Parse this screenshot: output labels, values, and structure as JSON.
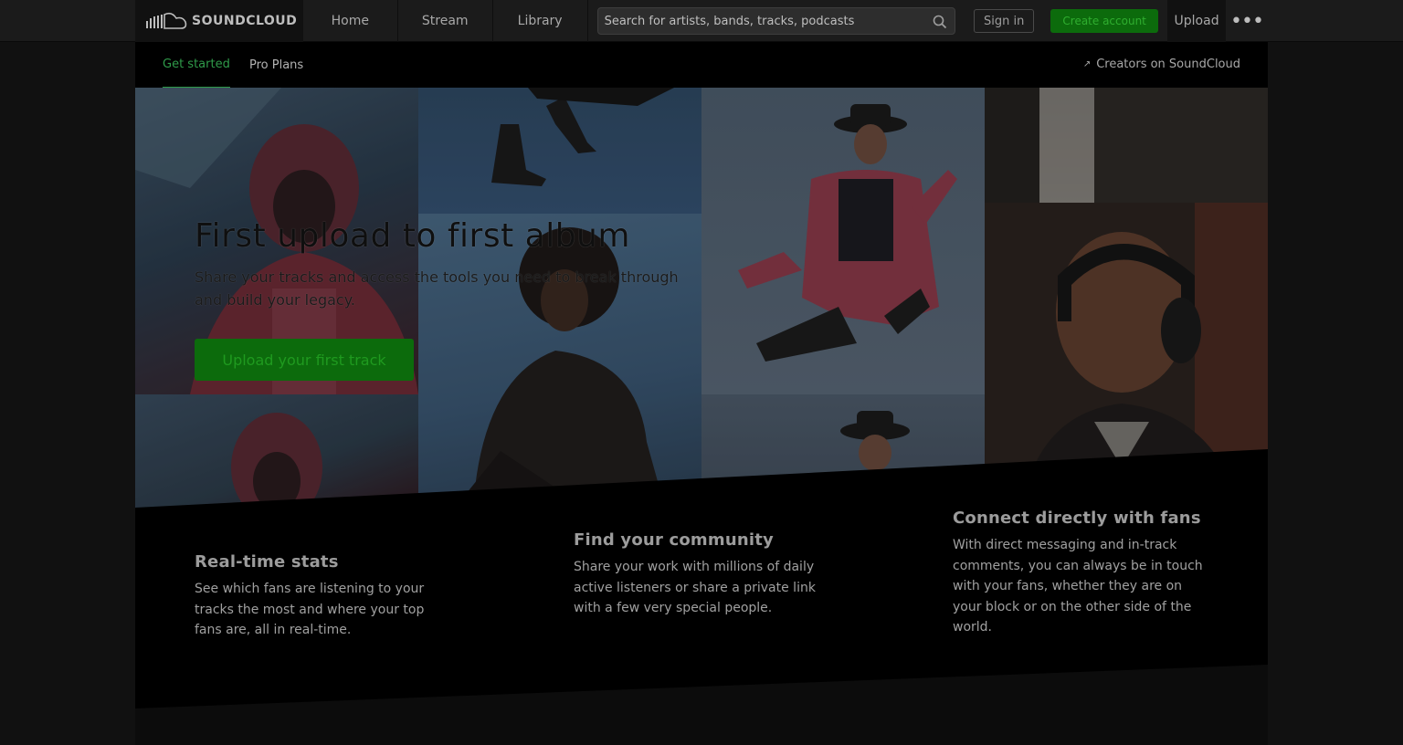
{
  "header": {
    "logo_text": "SOUNDCLOUD",
    "nav": [
      {
        "label": "Home"
      },
      {
        "label": "Stream"
      },
      {
        "label": "Library"
      }
    ],
    "search_placeholder": "Search for artists, bands, tracks, podcasts",
    "sign_in_label": "Sign in",
    "create_account_label": "Create account",
    "upload_label": "Upload",
    "more_label": "•••"
  },
  "subnav": {
    "tabs": [
      {
        "label": "Get started",
        "active": true
      },
      {
        "label": "Pro Plans",
        "active": false
      }
    ],
    "creators_label": "Creators on SoundCloud"
  },
  "hero": {
    "title": "First upload to first album",
    "subtitle": "Share your tracks and access the tools you need to break through and build your legacy.",
    "cta_label": "Upload your first track"
  },
  "features": [
    {
      "title": "Real-time stats",
      "text": "See which fans are listening to your tracks the most and where your top fans are, all in real-time."
    },
    {
      "title": "Find your community",
      "text": "Share your work with millions of daily active listeners or share a private link with a few very special people."
    },
    {
      "title": "Connect directly with fans",
      "text": "With direct messaging and in-track comments, you can always be in touch with your fans, whether they are on your block or on the other side of the world."
    }
  ],
  "colors": {
    "accent_green": "#0c6b0c",
    "active_tab": "#2f9b4a",
    "topbar": "#1b1b1b",
    "page_bg": "#000000"
  },
  "icons": {
    "logo": "soundcloud-cloud-icon",
    "search": "search-icon",
    "more": "more-dots-icon",
    "external": "external-link-icon"
  }
}
